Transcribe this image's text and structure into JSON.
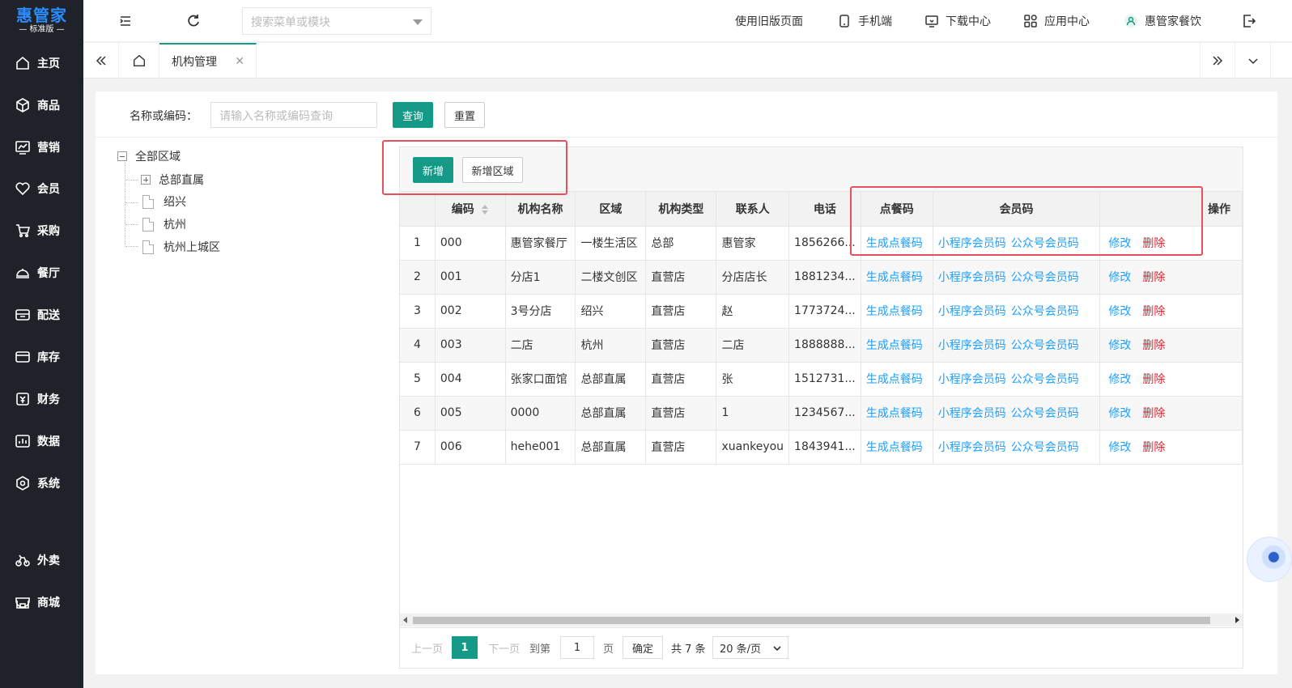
{
  "app": {
    "logo_main": "惠管家",
    "logo_sub": "— 标准版 —"
  },
  "sidebar": {
    "items": [
      {
        "label": "主页",
        "icon": "home-icon"
      },
      {
        "label": "商品",
        "icon": "box-icon"
      },
      {
        "label": "营销",
        "icon": "chart-icon"
      },
      {
        "label": "会员",
        "icon": "heart-icon"
      },
      {
        "label": "采购",
        "icon": "cart-icon"
      },
      {
        "label": "餐厅",
        "icon": "dish-icon"
      },
      {
        "label": "配送",
        "icon": "delivery-icon"
      },
      {
        "label": "库存",
        "icon": "inventory-icon"
      },
      {
        "label": "财务",
        "icon": "finance-icon"
      },
      {
        "label": "数据",
        "icon": "data-icon"
      },
      {
        "label": "系统",
        "icon": "settings-icon"
      },
      {
        "label": "外卖",
        "icon": "bike-icon"
      },
      {
        "label": "商城",
        "icon": "store-icon"
      }
    ]
  },
  "header": {
    "search_placeholder": "搜索菜单或模块",
    "old_version": "使用旧版页面",
    "mobile": "手机端",
    "downloads": "下载中心",
    "app_center": "应用中心",
    "user": "惠管家餐饮"
  },
  "tabs": {
    "active_label": "机构管理"
  },
  "filter": {
    "label": "名称或编码：",
    "placeholder": "请输入名称或编码查询",
    "query_btn": "查询",
    "reset_btn": "重置"
  },
  "tree": {
    "root": "全部区域",
    "children": [
      "总部直属",
      "绍兴",
      "杭州",
      "杭州上城区"
    ]
  },
  "toolbar": {
    "add_btn": "新增",
    "add_area_btn": "新增区域"
  },
  "table": {
    "columns": [
      "",
      "编码",
      "机构名称",
      "区域",
      "机构类型",
      "联系人",
      "电话",
      "点餐码",
      "会员码",
      "操作"
    ],
    "rows": [
      {
        "idx": "1",
        "code": "000",
        "name": "惠管家餐厅",
        "area": "一楼生活区",
        "type": "总部",
        "contact": "惠管家",
        "phone": "1856266..."
      },
      {
        "idx": "2",
        "code": "001",
        "name": "分店1",
        "area": "二楼文创区",
        "type": "直营店",
        "contact": "分店店长",
        "phone": "1881234..."
      },
      {
        "idx": "3",
        "code": "002",
        "name": "3号分店",
        "area": "绍兴",
        "type": "直营店",
        "contact": "赵",
        "phone": "1773724..."
      },
      {
        "idx": "4",
        "code": "003",
        "name": "二店",
        "area": "杭州",
        "type": "直营店",
        "contact": "二店",
        "phone": "1888888..."
      },
      {
        "idx": "5",
        "code": "004",
        "name": "张家口面馆",
        "area": "总部直属",
        "type": "直营店",
        "contact": "张",
        "phone": "1512731..."
      },
      {
        "idx": "6",
        "code": "005",
        "name": "0000",
        "area": "总部直属",
        "type": "直营店",
        "contact": "1",
        "phone": "1234567..."
      },
      {
        "idx": "7",
        "code": "006",
        "name": "hehe001",
        "area": "总部直属",
        "type": "直营店",
        "contact": "xuankeyou",
        "phone": "1843941..."
      }
    ],
    "actions": {
      "gen_order_code": "生成点餐码",
      "mini_member_code": "小程序会员码",
      "mp_member_code": "公众号会员码",
      "edit": "修改",
      "delete": "删除"
    }
  },
  "pager": {
    "prev": "上一页",
    "current": "1",
    "next": "下一页",
    "goto": "到第",
    "goto_value": "1",
    "page_unit": "页",
    "confirm": "确定",
    "total": "共 7 条",
    "page_size": "20 条/页"
  },
  "colors": {
    "primary": "#159a87",
    "link": "#1e9fff",
    "danger": "#e0222d",
    "sidebar_bg": "#1f2329",
    "logo": "#2b8cff",
    "highlight": "#e8515c"
  }
}
